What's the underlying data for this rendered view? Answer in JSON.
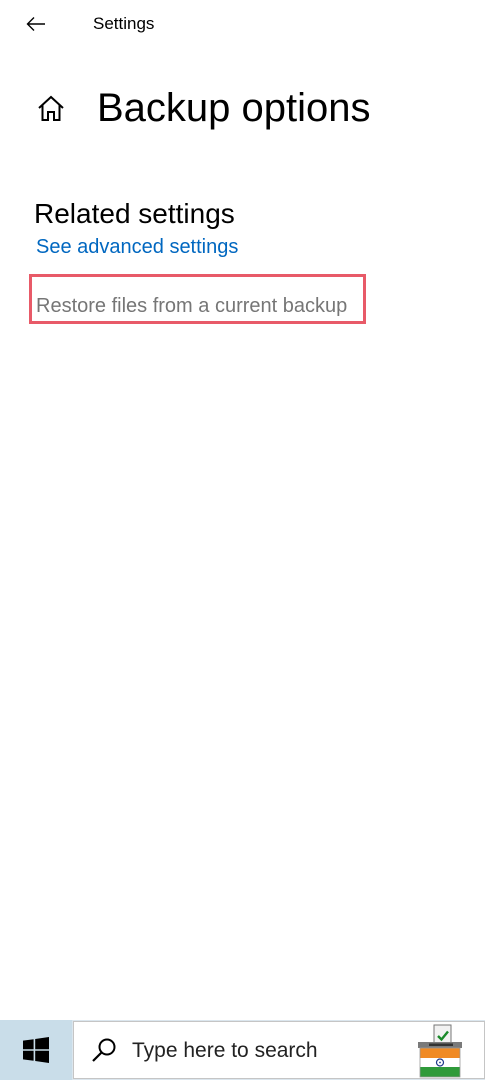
{
  "window": {
    "title": "Settings"
  },
  "page": {
    "title": "Backup options"
  },
  "related": {
    "heading": "Related settings",
    "advanced_link": "See advanced settings",
    "restore_link": "Restore files from a current backup"
  },
  "taskbar": {
    "search_placeholder": "Type here to search",
    "icons": [
      "windows-start-icon",
      "search-icon",
      "ballot-box-icon"
    ]
  },
  "colors": {
    "link": "#0067c0",
    "highlight_border": "#e85a68",
    "muted_text": "#767676",
    "taskbar": "#dbe6ee"
  }
}
